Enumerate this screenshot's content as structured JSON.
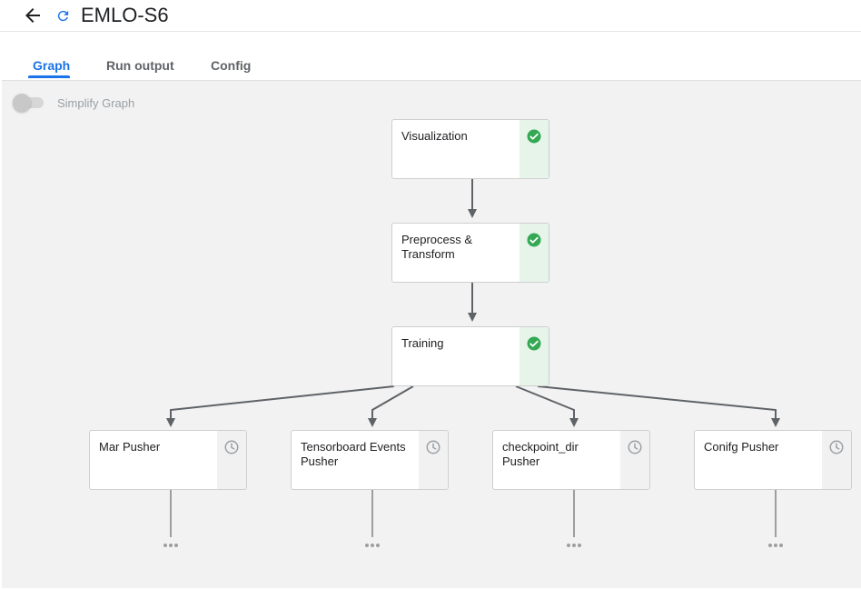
{
  "header": {
    "title": "EMLO-S6"
  },
  "tabs": [
    {
      "label": "Graph",
      "active": true
    },
    {
      "label": "Run output",
      "active": false
    },
    {
      "label": "Config",
      "active": false
    }
  ],
  "toolbar": {
    "simplify_graph_label": "Simplify Graph",
    "simplify_graph_enabled": false
  },
  "graph": {
    "nodes": [
      {
        "label": "Visualization",
        "status": "succeeded",
        "icon": "check-circle-icon"
      },
      {
        "label": "Preprocess & Transform",
        "status": "succeeded",
        "icon": "check-circle-icon"
      },
      {
        "label": "Training",
        "status": "succeeded",
        "icon": "check-circle-icon"
      },
      {
        "label": "Mar Pusher",
        "status": "pending",
        "icon": "clock-icon"
      },
      {
        "label": "Tensorboard Events Pusher",
        "status": "pending",
        "icon": "clock-icon"
      },
      {
        "label": "checkpoint_dir Pusher",
        "status": "pending",
        "icon": "clock-icon"
      },
      {
        "label": "Conifg Pusher",
        "status": "pending",
        "icon": "clock-icon"
      }
    ]
  },
  "colors": {
    "accent": "#1a73e8",
    "success": "#34a853",
    "pending": "#9aa0a6"
  }
}
